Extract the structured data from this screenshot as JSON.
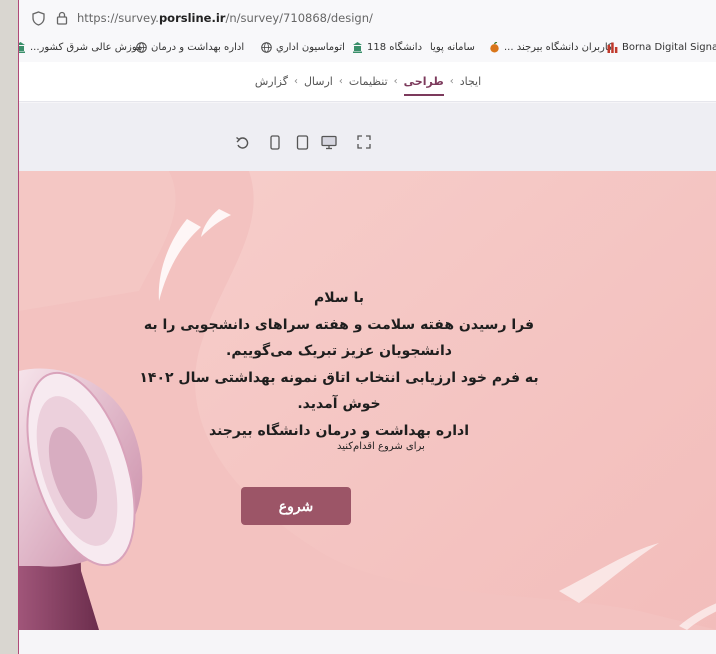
{
  "browser": {
    "url_prefix": "https://survey.",
    "url_domain": "porsline.ir",
    "url_path": "/n/survey/710868/design/"
  },
  "bookmarks": [
    {
      "label": "Borna Digital Signage...",
      "icon": "bar-chart-icon"
    },
    {
      "label": "... کاربران دانشگاه بیرجند",
      "icon": "apple-icon"
    },
    {
      "label": "سامانه پویا",
      "icon": "none"
    },
    {
      "label": "دانشگاه 118",
      "icon": "university-icon"
    },
    {
      "label": "اتوماسیون اداري",
      "icon": "globe-icon"
    },
    {
      "label": "اداره بهداشت و درمان",
      "icon": "globe-icon"
    },
    {
      "label": "...موزش عالی شرق کشور",
      "icon": "university-icon"
    }
  ],
  "steps": {
    "items": [
      "ایجاد",
      "طراحی",
      "تنظیمات",
      "ارسال",
      "گزارش"
    ],
    "active_index": 1
  },
  "toolbar": {
    "icons": [
      "undo-icon",
      "mobile-icon",
      "tablet-icon",
      "desktop-icon",
      "fullscreen-icon"
    ]
  },
  "welcome": {
    "lines": [
      "با سلام",
      "فرا رسیدن هفته سلامت و هفته سراهای دانشجویی را به",
      "دانشجویان عزیز تبریک می‌گوییم.",
      "به فرم خود ارزیابی انتخاب اتاق نمونه بهداشتی سال ۱۴۰۲",
      "خوش آمدید.",
      "اداره بهداشت و درمان دانشگاه بیرجند"
    ],
    "hint": "برای شروع اقدام‌کنید",
    "start_label": "شروع"
  },
  "colors": {
    "canvas_bg": "#f3c2c0",
    "button_bg": "#9c5567",
    "accent": "#7c3a5c",
    "frame_border": "#b04a78"
  }
}
